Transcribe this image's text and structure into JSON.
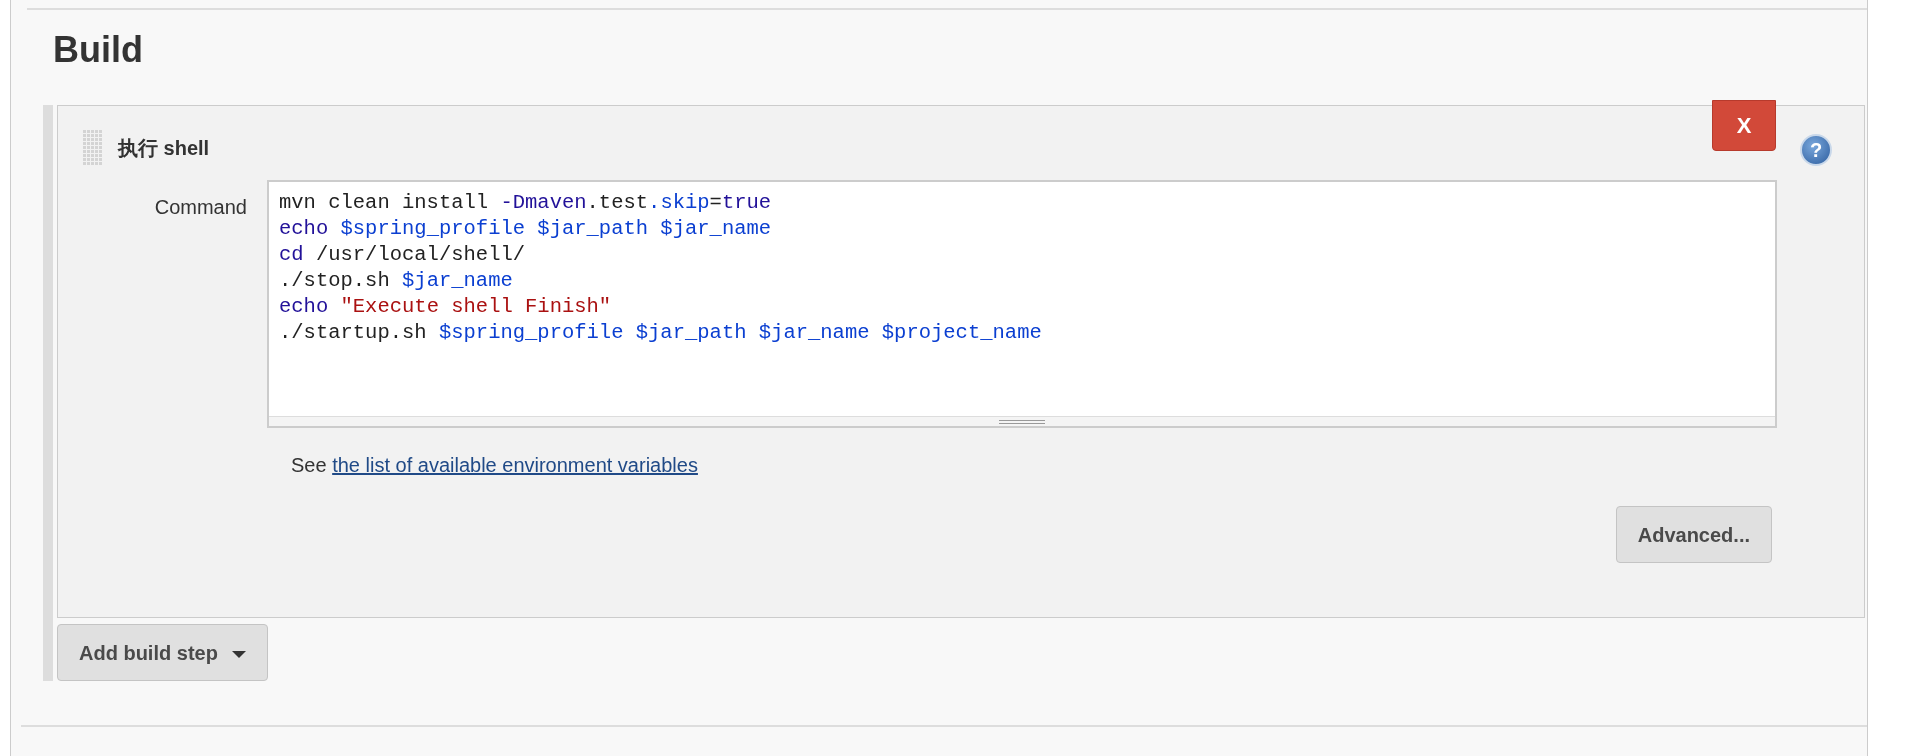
{
  "section": {
    "title": "Build"
  },
  "build_step": {
    "title": "执行 shell",
    "delete_button": "X",
    "help_button": "?",
    "field_label": "Command",
    "code_lines": [
      [
        {
          "text": "mvn clean install ",
          "kind": "plain"
        },
        {
          "text": "-Dmaven",
          "kind": "keyword"
        },
        {
          "text": ".test",
          "kind": "plain"
        },
        {
          "text": ".skip",
          "kind": "variable"
        },
        {
          "text": "=",
          "kind": "plain"
        },
        {
          "text": "true",
          "kind": "keyword"
        }
      ],
      [
        {
          "text": "echo ",
          "kind": "keyword"
        },
        {
          "text": "$spring_profile $jar_path $jar_name",
          "kind": "variable"
        }
      ],
      [
        {
          "text": "cd ",
          "kind": "keyword"
        },
        {
          "text": "/usr/local/shell/",
          "kind": "plain"
        }
      ],
      [
        {
          "text": "./stop.sh ",
          "kind": "plain"
        },
        {
          "text": "$jar_name",
          "kind": "variable"
        }
      ],
      [
        {
          "text": "echo ",
          "kind": "keyword"
        },
        {
          "text": "\"Execute shell Finish\"",
          "kind": "string"
        }
      ],
      [
        {
          "text": "./startup.sh ",
          "kind": "plain"
        },
        {
          "text": "$spring_profile $jar_path $jar_name $project_name",
          "kind": "variable"
        }
      ]
    ],
    "help_prefix": "See ",
    "help_link": "the list of available environment variables",
    "advanced_button": "Advanced..."
  },
  "add_step_button": "Add build step"
}
